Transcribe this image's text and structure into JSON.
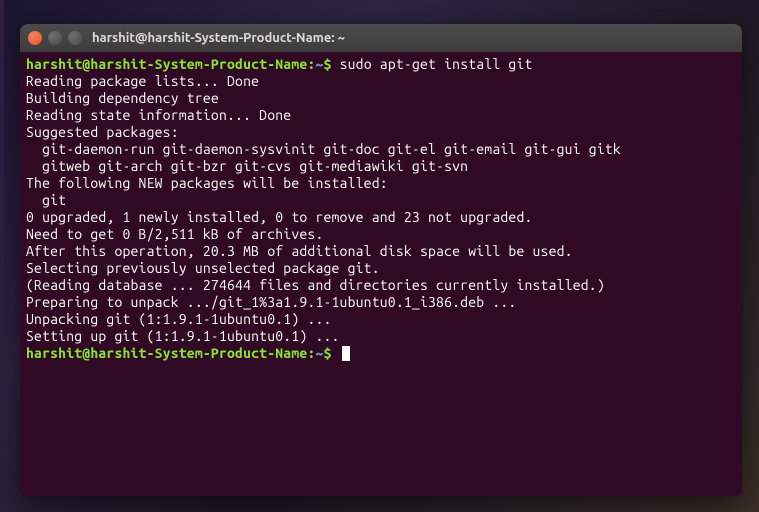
{
  "titlebar": {
    "title": "harshit@harshit-System-Product-Name: ~"
  },
  "prompt": {
    "userhost": "harshit@harshit-System-Product-Name",
    "sep": ":",
    "path": "~",
    "sigil": "$"
  },
  "command": "sudo apt-get install git",
  "output": {
    "l1": "Reading package lists... Done",
    "l2": "Building dependency tree",
    "l3": "Reading state information... Done",
    "l4": "Suggested packages:",
    "l5": "  git-daemon-run git-daemon-sysvinit git-doc git-el git-email git-gui gitk",
    "l6": "  gitweb git-arch git-bzr git-cvs git-mediawiki git-svn",
    "l7": "The following NEW packages will be installed:",
    "l8": "  git",
    "l9": "0 upgraded, 1 newly installed, 0 to remove and 23 not upgraded.",
    "l10": "Need to get 0 B/2,511 kB of archives.",
    "l11": "After this operation, 20.3 MB of additional disk space will be used.",
    "l12": "Selecting previously unselected package git.",
    "l13": "(Reading database ... 274644 files and directories currently installed.)",
    "l14": "Preparing to unpack .../git_1%3a1.9.1-1ubuntu0.1_i386.deb ...",
    "l15": "Unpacking git (1:1.9.1-1ubuntu0.1) ...",
    "l16": "Setting up git (1:1.9.1-1ubuntu0.1) ..."
  }
}
